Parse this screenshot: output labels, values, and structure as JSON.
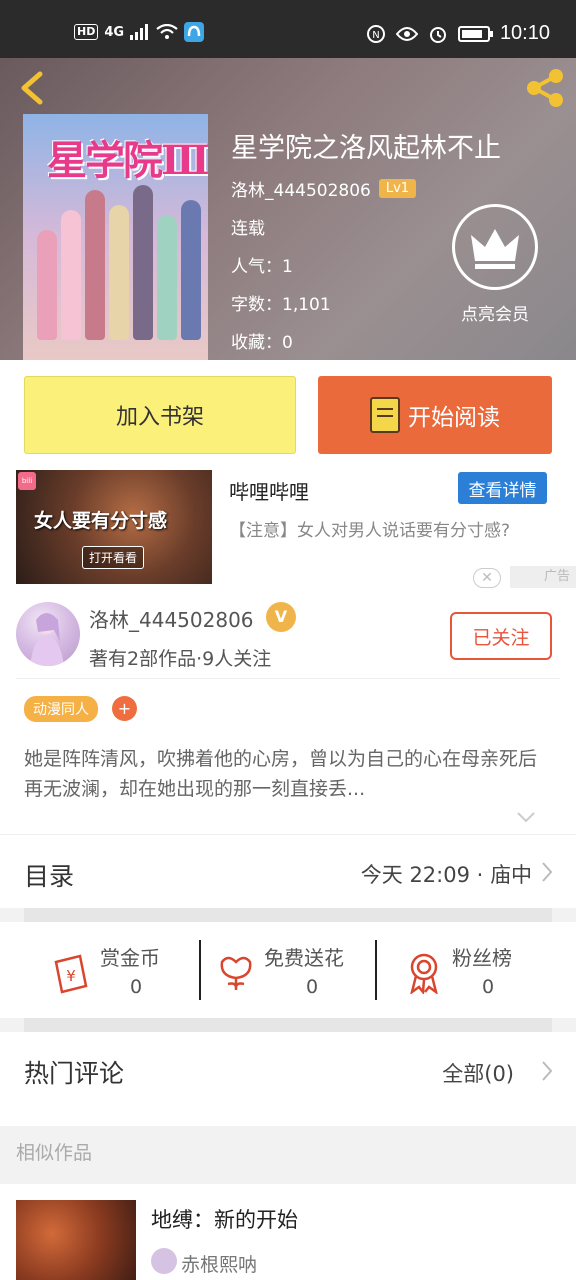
{
  "status_bar": {
    "left_labels": [
      "HD",
      "4G"
    ],
    "time": "10:10"
  },
  "book": {
    "title": "星学院之洛风起林不止",
    "author": "洛林_444502806",
    "level": "Lv1",
    "status": "连载",
    "popularity": "人气：1",
    "word_count": "字数：1,101",
    "favorites": "收藏：0",
    "cover_title": "星学院Ⅲ",
    "vip_label": "点亮会员"
  },
  "actions": {
    "add_shelf": "加入书架",
    "start_read": "开始阅读"
  },
  "ad": {
    "title": "哔哩哔哩",
    "detail_button": "查看详情",
    "description": "【注意】女人对男人说话要有分寸感?",
    "image_text": "女人要有分寸感",
    "image_button": "打开看看",
    "logo_text": "bili",
    "close": "✕",
    "tag": "广告"
  },
  "author_card": {
    "name": "洛林_444502806",
    "badge": "V",
    "works": "著有2部作品·9人关注",
    "follow_button": "已关注",
    "tag": "动漫同人",
    "tag_add": "+",
    "intro": "她是阵阵清风，吹拂着他的心房，曾以为自己的心在母亲死后再无波澜，却在她出现的那一刻直接丢..."
  },
  "toc": {
    "title": "目录",
    "latest": "今天 22:09 · 庙中"
  },
  "stats": [
    {
      "label": "赏金币",
      "value": "0",
      "icon": "reward-coin-icon"
    },
    {
      "label": "免费送花",
      "value": "0",
      "icon": "flower-icon"
    },
    {
      "label": "粉丝榜",
      "value": "0",
      "icon": "medal-icon"
    }
  ],
  "comments": {
    "title": "热门评论",
    "all": "全部(0)"
  },
  "similar": {
    "heading": "相似作品",
    "items": [
      {
        "title": "地缚：新的开始",
        "author": "赤根熙呐"
      }
    ]
  },
  "colors": {
    "accent_orange": "#eb6a3c",
    "shelf_yellow": "#fbf07a",
    "ad_blue": "#2c7fd6",
    "level_gold": "#f0b54a"
  }
}
